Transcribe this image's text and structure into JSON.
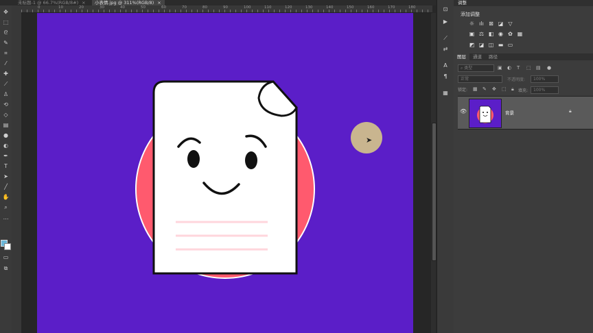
{
  "document_tabs": [
    {
      "label": "未标题-1 @ 66.7%(RGB/8#)",
      "close": "×",
      "active": false
    },
    {
      "label": "小表情.jpg @ 311%(RGB/8)",
      "close": "×",
      "active": true
    }
  ],
  "ruler": {
    "top_labels": [
      "0",
      "10",
      "20",
      "30",
      "40",
      "50",
      "60",
      "70",
      "80",
      "90",
      "100",
      "110",
      "120",
      "130",
      "140",
      "150",
      "160",
      "170",
      "180"
    ]
  },
  "toolbar": {
    "tools": [
      "move-icon",
      "marquee-icon",
      "lasso-icon",
      "quick-select-icon",
      "crop-icon",
      "eyedropper-icon",
      "healing-icon",
      "brush-icon",
      "stamp-icon",
      "history-brush-icon",
      "eraser-icon",
      "gradient-icon",
      "blur-icon",
      "dodge-icon",
      "pen-icon",
      "type-icon",
      "path-select-icon",
      "line-icon",
      "hand-icon",
      "zoom-icon",
      "more-icon"
    ],
    "foreground_color": "#6bb7d8",
    "background_color": "#ffffff"
  },
  "canvas": {
    "background": "#5b1ec8",
    "circle_color": "#ff5a6e",
    "paper_color": "#ffffff",
    "line_color": "#ffd6dc"
  },
  "panels": {
    "adjustments_tab": "调整",
    "add_adjustment": "添加调整",
    "layers_tabs": [
      "图层",
      "通道",
      "路径"
    ],
    "kind_filter": "类型",
    "blend_mode": "正常",
    "opacity_label": "不透明度:",
    "opacity_value": "100%",
    "lock_label": "锁定:",
    "fill_label": "填充:",
    "fill_value": "100%",
    "layer_name": "背景"
  },
  "colors": {
    "accent_purple": "#5b1ec8",
    "cursor_highlight": "#c9b58f"
  }
}
